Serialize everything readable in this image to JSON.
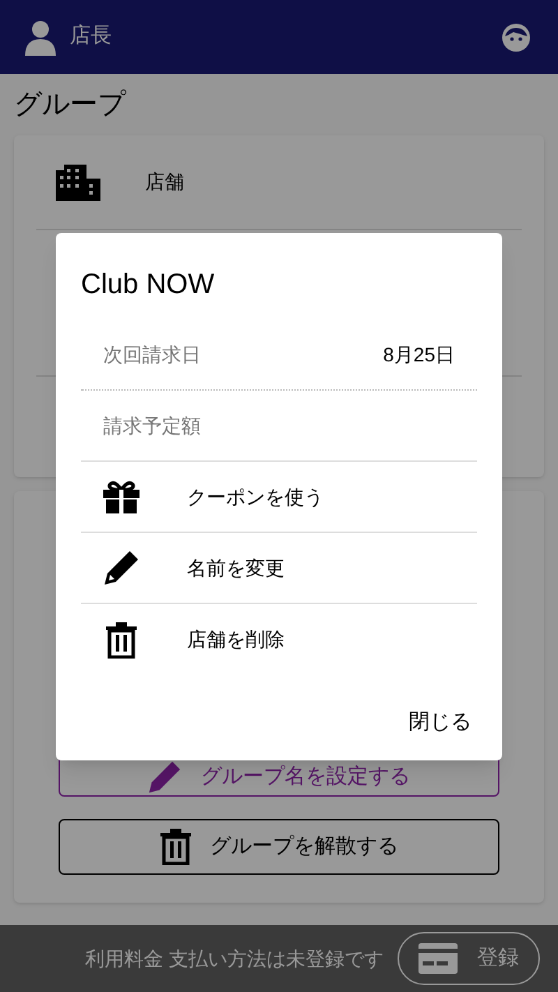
{
  "header": {
    "title": "店長"
  },
  "page_title": "グループ",
  "store_card": {
    "label": "店舗"
  },
  "group_actions": [
    {
      "kind": "rename",
      "label": "グループ名を設定する"
    },
    {
      "kind": "disband",
      "label": "グループを解散する"
    }
  ],
  "footer": {
    "message": "利用料金 支払い方法は未登録です",
    "button": "登録"
  },
  "dialog": {
    "title": "Club NOW",
    "details": [
      {
        "label": "次回請求日",
        "value": "8月25日"
      },
      {
        "label": "請求予定額"
      }
    ],
    "actions": [
      {
        "kind": "gift",
        "label": "クーポンを使う"
      },
      {
        "kind": "pencil",
        "label": "名前を変更"
      },
      {
        "kind": "trash",
        "label": "店舗を削除"
      }
    ],
    "close": "閉じる"
  }
}
